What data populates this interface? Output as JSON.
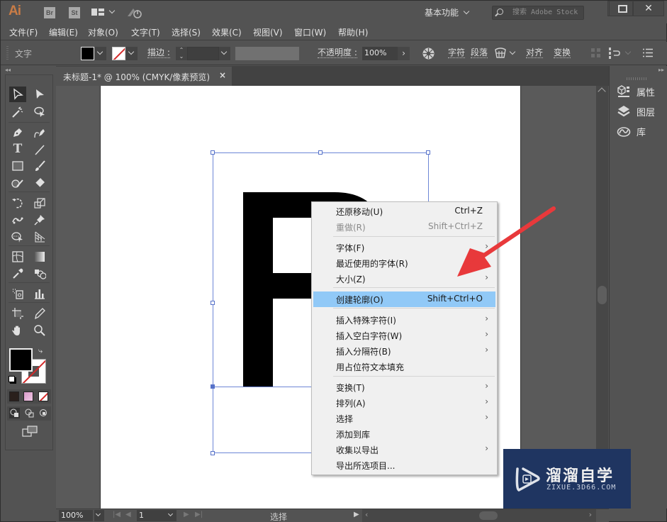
{
  "titlebar": {
    "app_logo": "Ai",
    "bridge_label": "Br",
    "stock_label": "St",
    "workspace": "基本功能",
    "search_placeholder": "搜索 Adobe Stock",
    "close_glyph": "✕"
  },
  "menubar": {
    "items": [
      {
        "label": "文件(F)"
      },
      {
        "label": "编辑(E)"
      },
      {
        "label": "对象(O)"
      },
      {
        "label": "文字(T)"
      },
      {
        "label": "选择(S)"
      },
      {
        "label": "效果(C)"
      },
      {
        "label": "视图(V)"
      },
      {
        "label": "窗口(W)"
      },
      {
        "label": "帮助(H)"
      }
    ]
  },
  "controlbar": {
    "selection_type": "文字",
    "fill_color": "#000000",
    "stroke_label": "描边 :",
    "opacity_label": "不透明度 :",
    "opacity_value": "100%",
    "char_link": "字符",
    "para_link": "段落",
    "align_link": "对齐",
    "transform_link": "变换"
  },
  "document": {
    "tab_title": "未标题-1* @ 100% (CMYK/像素预览)",
    "close_glyph": "×",
    "letter": "P"
  },
  "right_panel": {
    "items": [
      {
        "label": "属性",
        "icon": "properties-icon"
      },
      {
        "label": "图层",
        "icon": "layers-icon"
      },
      {
        "label": "库",
        "icon": "libraries-icon"
      }
    ]
  },
  "statusbar": {
    "zoom": "100%",
    "artboard_number": "1",
    "status_text": "选择"
  },
  "context_menu": {
    "items": [
      {
        "label": "还原移动(U)",
        "shortcut": "Ctrl+Z",
        "submenu": false,
        "disabled": false
      },
      {
        "label": "重做(R)",
        "shortcut": "Shift+Ctrl+Z",
        "submenu": false,
        "disabled": true
      },
      {
        "label": "字体(F)",
        "shortcut": "",
        "submenu": true,
        "disabled": false
      },
      {
        "label": "最近使用的字体(R)",
        "shortcut": "",
        "submenu": true,
        "disabled": false
      },
      {
        "label": "大小(Z)",
        "shortcut": "",
        "submenu": true,
        "disabled": false
      },
      {
        "label": "创建轮廓(O)",
        "shortcut": "Shift+Ctrl+O",
        "submenu": false,
        "disabled": false,
        "highlighted": true
      },
      {
        "label": "插入特殊字符(I)",
        "shortcut": "",
        "submenu": true,
        "disabled": false
      },
      {
        "label": "插入空白字符(W)",
        "shortcut": "",
        "submenu": true,
        "disabled": false
      },
      {
        "label": "插入分隔符(B)",
        "shortcut": "",
        "submenu": true,
        "disabled": false
      },
      {
        "label": "用占位符文本填充",
        "shortcut": "",
        "submenu": false,
        "disabled": false
      },
      {
        "label": "变换(T)",
        "shortcut": "",
        "submenu": true,
        "disabled": false
      },
      {
        "label": "排列(A)",
        "shortcut": "",
        "submenu": true,
        "disabled": false
      },
      {
        "label": "选择",
        "shortcut": "",
        "submenu": true,
        "disabled": false
      },
      {
        "label": "添加到库",
        "shortcut": "",
        "submenu": false,
        "disabled": false
      },
      {
        "label": "收集以导出",
        "shortcut": "",
        "submenu": true,
        "disabled": false
      },
      {
        "label": "导出所选项目...",
        "shortcut": "",
        "submenu": false,
        "disabled": false
      }
    ],
    "submenu_glyph": "›",
    "highlight_color": "#91c9f7"
  },
  "annotation": {
    "arrow_color": "#e8393b"
  },
  "watermark": {
    "title": "溜溜自学",
    "url": "ZIXUE.3D66.COM"
  },
  "colors": {
    "ui_bg": "#535353",
    "selection_blue": "#6d86d6",
    "accent_orange": "#c97c46"
  }
}
